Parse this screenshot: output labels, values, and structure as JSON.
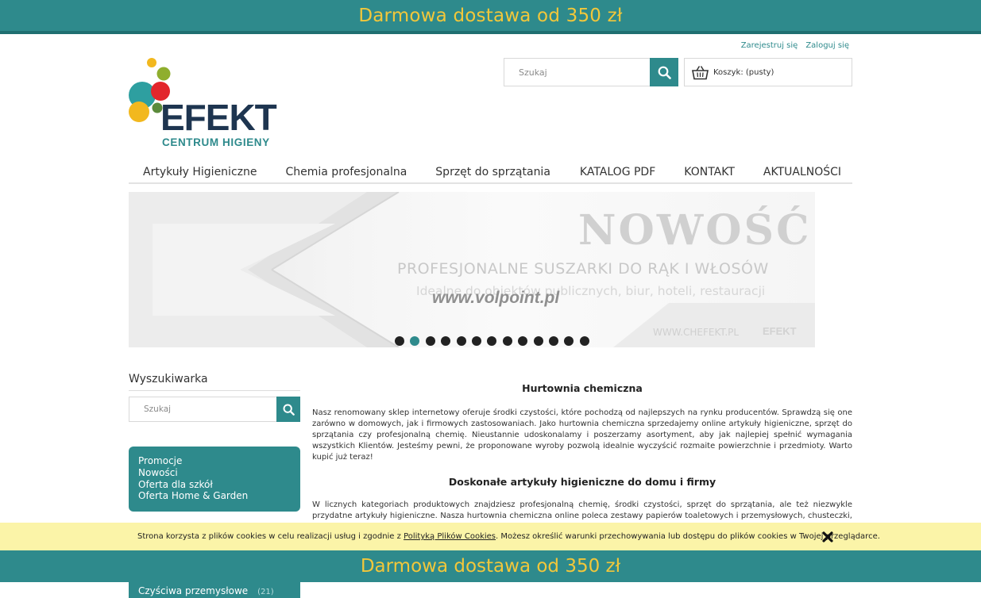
{
  "promo_bar": {
    "text": "Darmowa dostawa od 350 zł"
  },
  "account": {
    "register": "Zarejestruj się",
    "login": "Zaloguj się"
  },
  "header_search": {
    "placeholder": "Szukaj"
  },
  "cart": {
    "label": "Koszyk: (pusty)"
  },
  "logo": {
    "brand": "EFEKT",
    "subtitle": "CENTRUM HIGIENY"
  },
  "nav": {
    "items": [
      "Artykuły Higieniczne",
      "Chemia profesjonalna",
      "Sprzęt do sprzątania",
      "KATALOG PDF",
      "KONTAKT",
      "AKTUALNOŚCI"
    ]
  },
  "slider": {
    "headline": "NOWOŚĆ",
    "subline": "PROFESJONALNE SUSZARKI DO RĄK I WŁOSÓW",
    "tagline": "Idealne do obiektów publicznych, biur, hoteli, restauracji",
    "watermark": "www.volpoint.pl",
    "site": "WWW.CHEFEKT.PL",
    "mini_logo": "EFEKT",
    "dot_count": 13,
    "active_dot": 1
  },
  "sidebar": {
    "title": "Wyszukiwarka",
    "search_placeholder": "Szukaj",
    "menu": [
      "Promocje",
      "Nowości",
      "Oferta dla szkół",
      "Oferta Home & Garden"
    ],
    "category": {
      "label": "Czyściwa przemysłowe",
      "count": "(21)"
    }
  },
  "content": {
    "heading1": "Hurtownia chemiczna",
    "para1": "Nasz renomowany sklep internetowy oferuje środki czystości, które pochodzą od najlepszych na rynku producentów. Sprawdzą się one zarówno w domowych, jak i firmowych zastosowaniach. Jako hurtownia chemiczna sprzedajemy online artykuły higieniczne, sprzęt do sprzątania czy profesjonalną chemię. Nieustannie udoskonalamy i poszerzamy asortyment, aby jak najlepiej spełnić wymagania wszystkich Klientów. Jesteśmy pewni, że proponowane wyroby pozwolą idealnie wyczyścić rozmaite powierzchnie i przedmioty. Warto kupić już teraz!",
    "heading2": "Doskonałe artykuły higieniczne do domu i firmy",
    "para2": "W licznych kategoriach produktowych znajdziesz profesjonalną chemię, środki czystości, sprzęt do sprzątania, ale też niezwykle przydatne artykuły higieniczne. Nasza hurtownia chemiczna online poleca zestawy papierów toaletowych i przemysłowych, chusteczki, serwetki oraz wytrzymałe ręczniki kuchenne. W sklepie internetowym Centrum Higieny Efekt mamy też bardzo chłonne czyściwa, które nadają się do kontaktu z żywnością."
  },
  "cookie": {
    "text_before": "Strona korzysta z plików cookies w celu realizacji usług i zgodnie z ",
    "link": "Polityką Plików Cookies",
    "text_after": ". Możesz określić warunki przechowywania lub dostępu do plików cookies w Twojej przeglądarce."
  },
  "colors": {
    "teal": "#2e8a8c",
    "yellow": "#f2c73a",
    "navy": "#1e3550",
    "cookie_bg": "#fbf4a8"
  }
}
